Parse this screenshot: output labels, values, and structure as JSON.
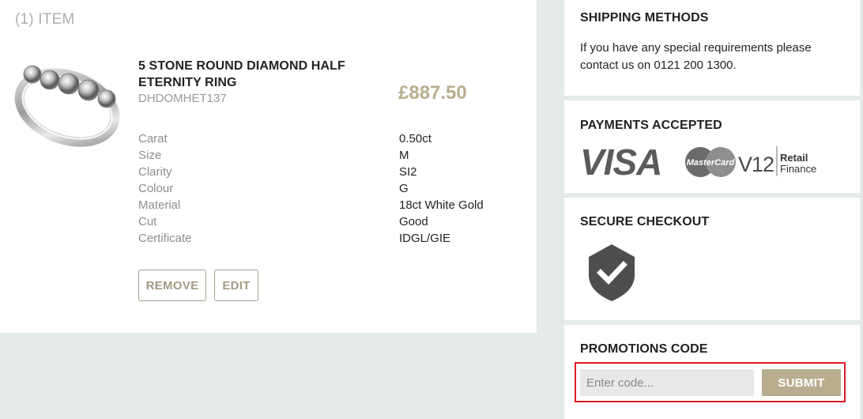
{
  "cart": {
    "count_label": "(1) ITEM",
    "item": {
      "title": "5 STONE ROUND DIAMOND HALF ETERNITY RING",
      "sku": "DHDOMHET137",
      "price": "£887.50",
      "specs": [
        {
          "label": "Carat",
          "value": "0.50ct"
        },
        {
          "label": "Size",
          "value": "M"
        },
        {
          "label": "Clarity",
          "value": "SI2"
        },
        {
          "label": "Colour",
          "value": "G"
        },
        {
          "label": "Material",
          "value": "18ct White Gold"
        },
        {
          "label": "Cut",
          "value": "Good"
        },
        {
          "label": "Certificate",
          "value": "IDGL/GIE"
        }
      ],
      "remove_label": "REMOVE",
      "edit_label": "EDIT"
    }
  },
  "shipping": {
    "title": "SHIPPING METHODS",
    "text": "If you have any special requirements please contact us on 0121 200 1300."
  },
  "payments": {
    "title": "PAYMENTS ACCEPTED",
    "visa": "VISA",
    "mastercard": "MasterCard",
    "v12": "V12",
    "retail": "Retail",
    "finance": "Finance"
  },
  "secure": {
    "title": "SECURE CHECKOUT",
    "icon": "shield-check-icon"
  },
  "promo": {
    "title": "PROMOTIONS CODE",
    "placeholder": "Enter code...",
    "value": "",
    "submit_label": "SUBMIT"
  },
  "colors": {
    "accent": "#b8ad8e",
    "page_bg": "#e4ebea",
    "highlight": "#e01b24"
  }
}
